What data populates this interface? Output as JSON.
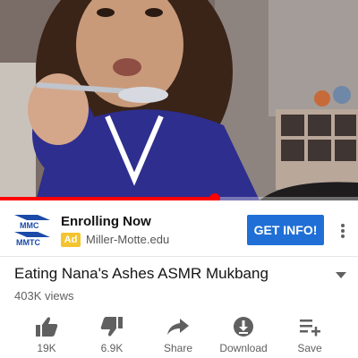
{
  "video": {
    "progress_fraction": 0.6,
    "progress_color": "#ff0000"
  },
  "ad": {
    "logo_icon": "mmc-mmtc-logo",
    "logo_text_top": "MMC",
    "logo_text_bottom": "MMTC",
    "title": "Enrolling Now",
    "badge": "Ad",
    "badge_color": "#f4c430",
    "url": "Miller-Motte.edu",
    "cta_label": "GET INFO!",
    "cta_color": "#1f6fd6",
    "more_icon": "more-vert-icon"
  },
  "video_info": {
    "title": "Eating Nana's Ashes ASMR Mukbang",
    "views": "403K views",
    "expand_icon": "caret-down-icon"
  },
  "actions": [
    {
      "icon": "thumb-up-icon",
      "label": "19K"
    },
    {
      "icon": "thumb-down-icon",
      "label": "6.9K"
    },
    {
      "icon": "share-icon",
      "label": "Share"
    },
    {
      "icon": "download-icon",
      "label": "Download"
    },
    {
      "icon": "playlist-add-icon",
      "label": "Save"
    }
  ]
}
